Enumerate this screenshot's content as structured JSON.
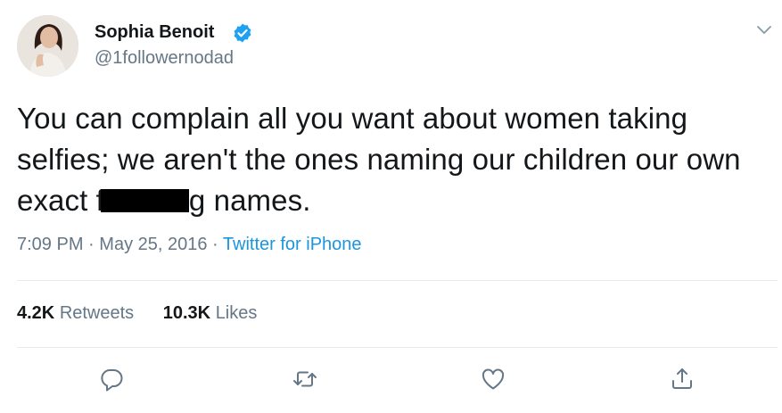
{
  "author": {
    "display_name": "Sophia Benoit",
    "username": "@1followernodad",
    "verified_icon": "verified-badge-icon",
    "avatar_icon": "avatar"
  },
  "tweet": {
    "line1": "You can complain all you want about women taking",
    "line2": "selfies; we aren't the ones naming our children our own",
    "line3_before": "exact f",
    "line3_after": "g names.",
    "time": "7:09 PM",
    "date": "May 25, 2016",
    "separator": "·",
    "source": "Twitter for iPhone"
  },
  "stats": {
    "retweets_count": "4.2K",
    "retweets_label": "Retweets",
    "likes_count": "10.3K",
    "likes_label": "Likes"
  },
  "actions": [
    "reply-icon",
    "retweet-icon",
    "like-icon",
    "share-icon"
  ],
  "colors": {
    "text": "#14171a",
    "secondary": "#657786",
    "link": "#1b95e0",
    "verified": "#1da1f2",
    "divider": "#e6ecf0"
  }
}
